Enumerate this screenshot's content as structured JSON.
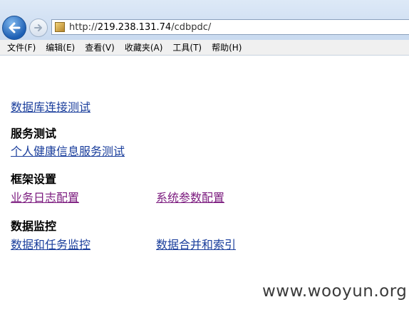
{
  "browser": {
    "url_prefix": "http://",
    "url_host": "219.238.131.74",
    "url_path": "/cdbpdc/"
  },
  "menu": [
    {
      "label": "文件(F)"
    },
    {
      "label": "编辑(E)"
    },
    {
      "label": "查看(V)"
    },
    {
      "label": "收藏夹(A)"
    },
    {
      "label": "工具(T)"
    },
    {
      "label": "帮助(H)"
    }
  ],
  "content": {
    "db_test_link": "数据库连接测试",
    "service_test": {
      "title": "服务测试",
      "links": [
        "个人健康信息服务测试"
      ]
    },
    "framework": {
      "title": "框架设置",
      "links": [
        "业务日志配置",
        "系统参数配置"
      ]
    },
    "monitoring": {
      "title": "数据监控",
      "links": [
        "数据和任务监控",
        "数据合并和索引"
      ]
    }
  },
  "watermark": "www.wooyun.org"
}
